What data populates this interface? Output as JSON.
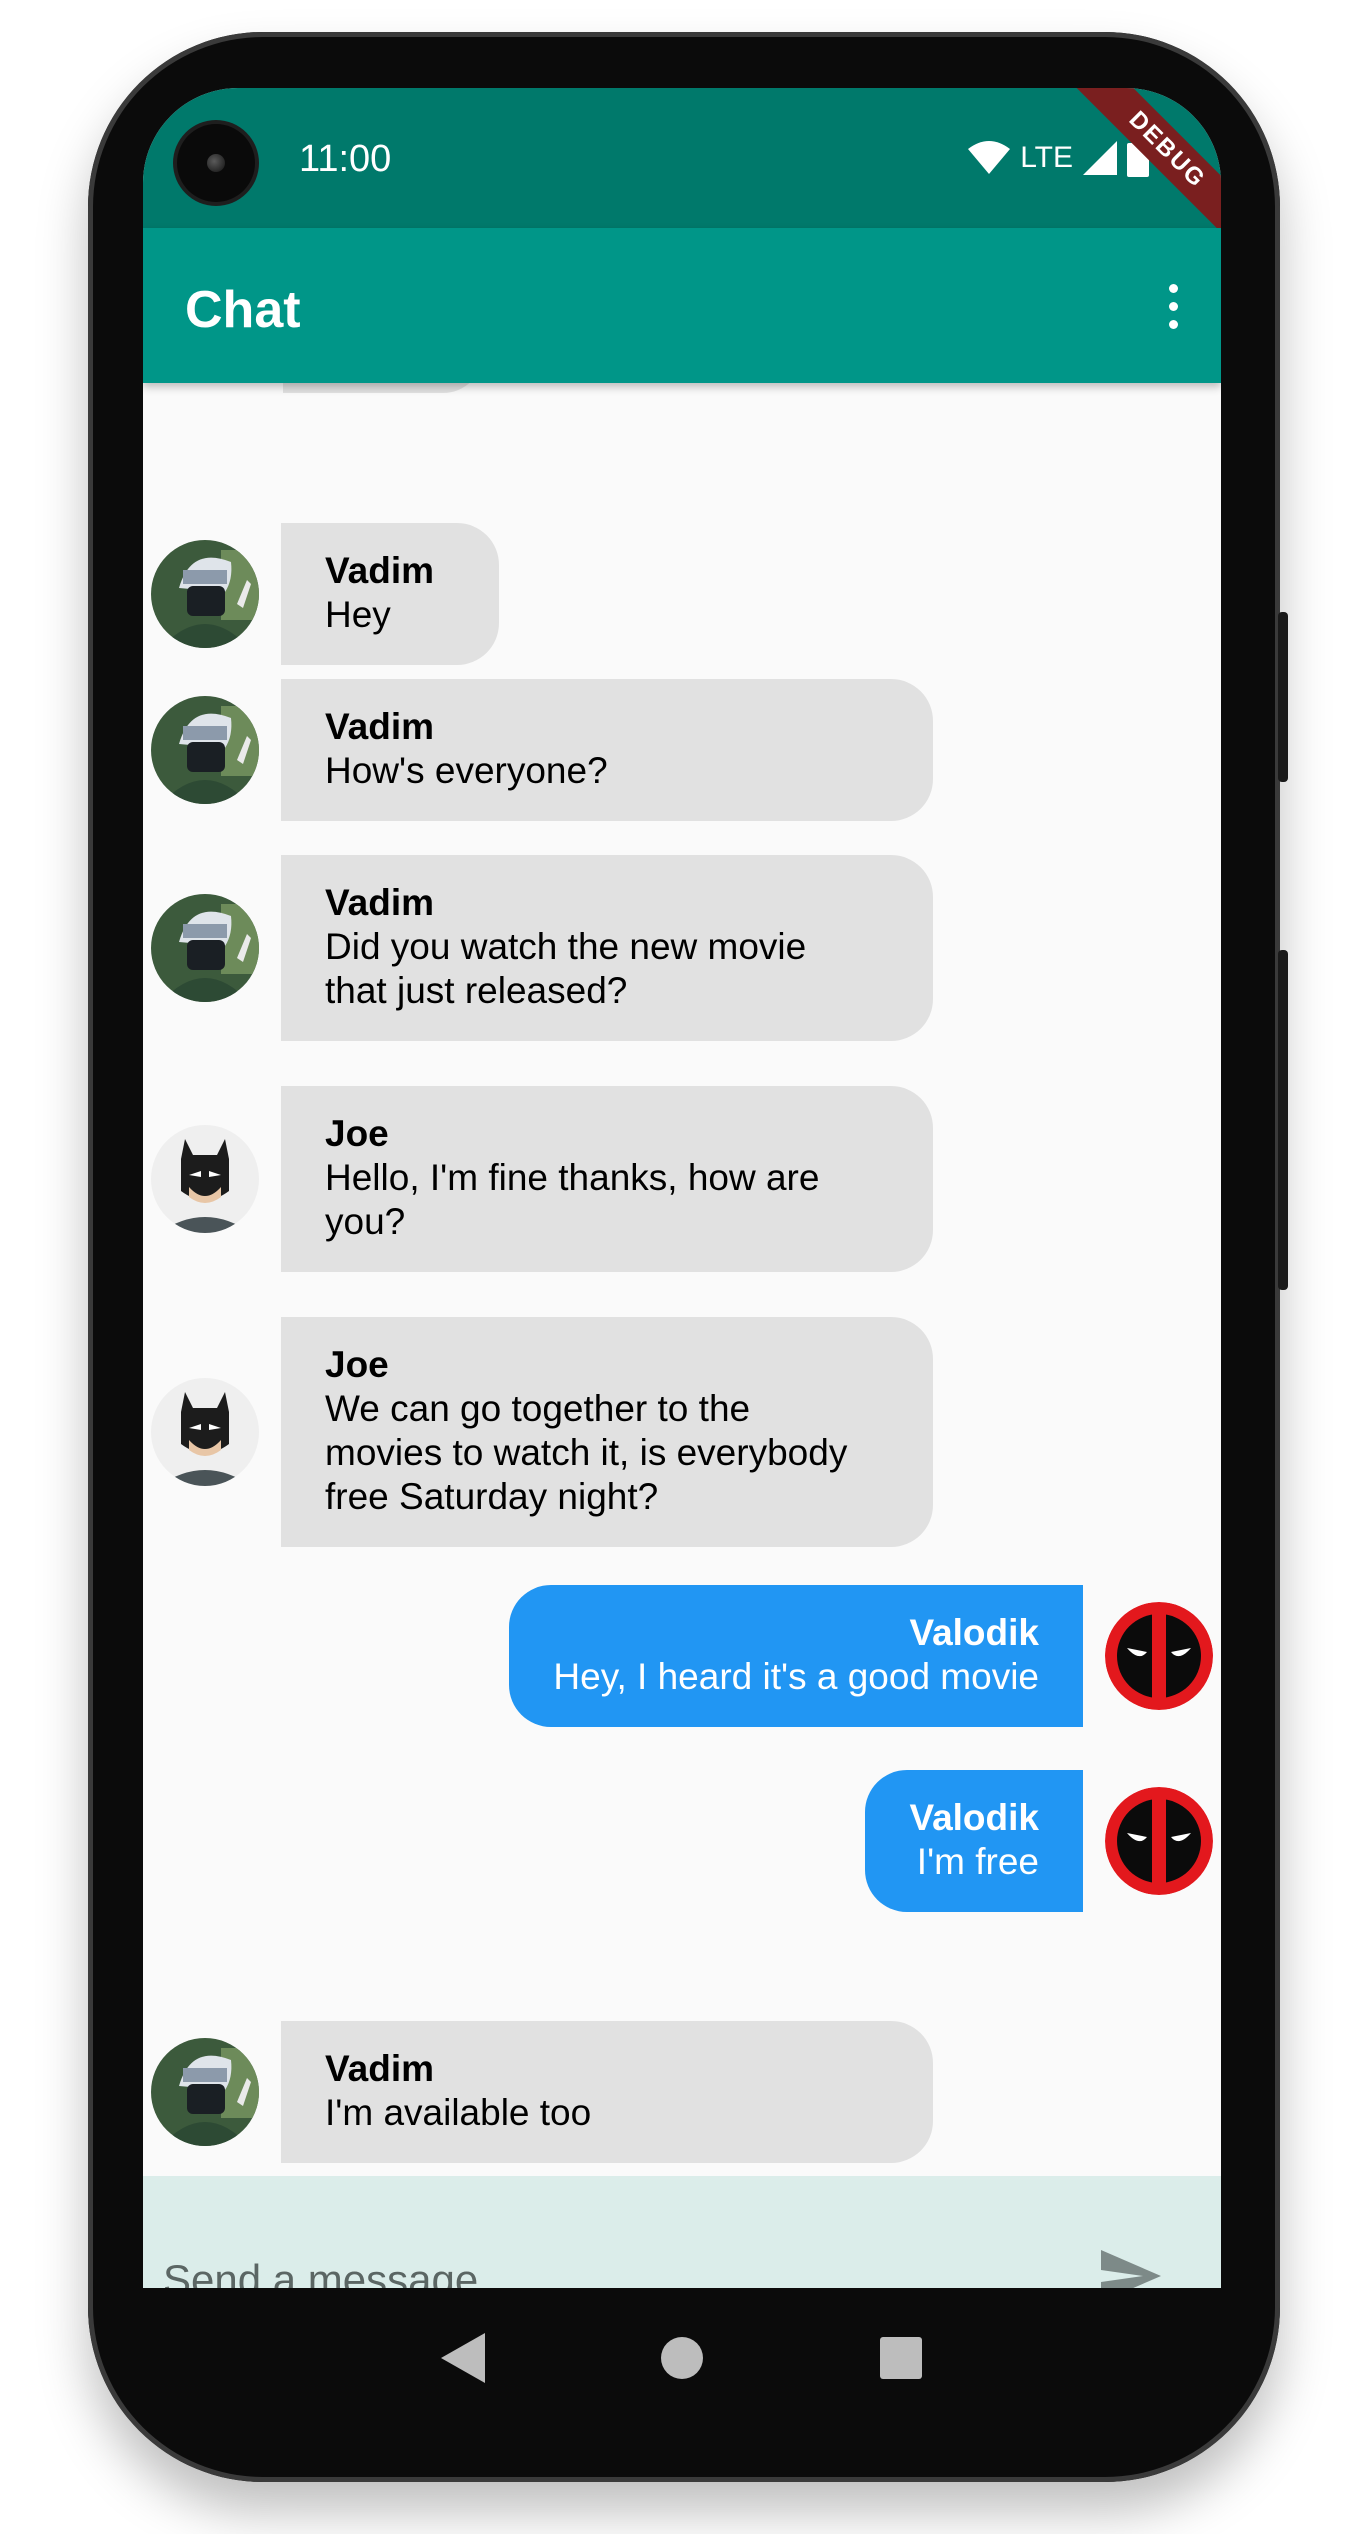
{
  "status_bar": {
    "time": "11:00",
    "network": "LTE",
    "debug_label": "DEBUG"
  },
  "app_bar": {
    "title": "Chat",
    "menu_icon": "more-vert-icon"
  },
  "messages": [
    {
      "sender": "Vadim",
      "text": "Hey",
      "direction": "incoming",
      "avatar": "kakashi-avatar"
    },
    {
      "sender": "Vadim",
      "text": "How's everyone?",
      "direction": "incoming",
      "avatar": "kakashi-avatar"
    },
    {
      "sender": "Vadim",
      "text": "Did you watch the new movie\nthat just released?",
      "direction": "incoming",
      "avatar": "kakashi-avatar"
    },
    {
      "sender": "Joe",
      "text": "Hello, I'm fine thanks, how are\nyou?",
      "direction": "incoming",
      "avatar": "batman-avatar"
    },
    {
      "sender": "Joe",
      "text": "We can go together to the\nmovies to watch it, is everybody\nfree Saturday night?",
      "direction": "incoming",
      "avatar": "batman-avatar"
    },
    {
      "sender": "Valodik",
      "text": "Hey, I heard it's a good movie",
      "direction": "outgoing",
      "avatar": "deadpool-avatar"
    },
    {
      "sender": "Valodik",
      "text": "I'm free",
      "direction": "outgoing",
      "avatar": "deadpool-avatar"
    },
    {
      "sender": "Vadim",
      "text": "I'm available too",
      "direction": "incoming",
      "avatar": "kakashi-avatar"
    }
  ],
  "composer": {
    "placeholder": "Send a message...",
    "value": "",
    "send_icon": "send-icon"
  },
  "nav_bar": {
    "back_icon": "back-icon",
    "home_icon": "home-icon",
    "recents_icon": "recents-icon"
  },
  "colors": {
    "status_bar": "#00796b",
    "app_bar": "#009688",
    "incoming_bubble": "#e1e1e1",
    "outgoing_bubble": "#2196f3",
    "composer_bg": "#dbedea"
  }
}
